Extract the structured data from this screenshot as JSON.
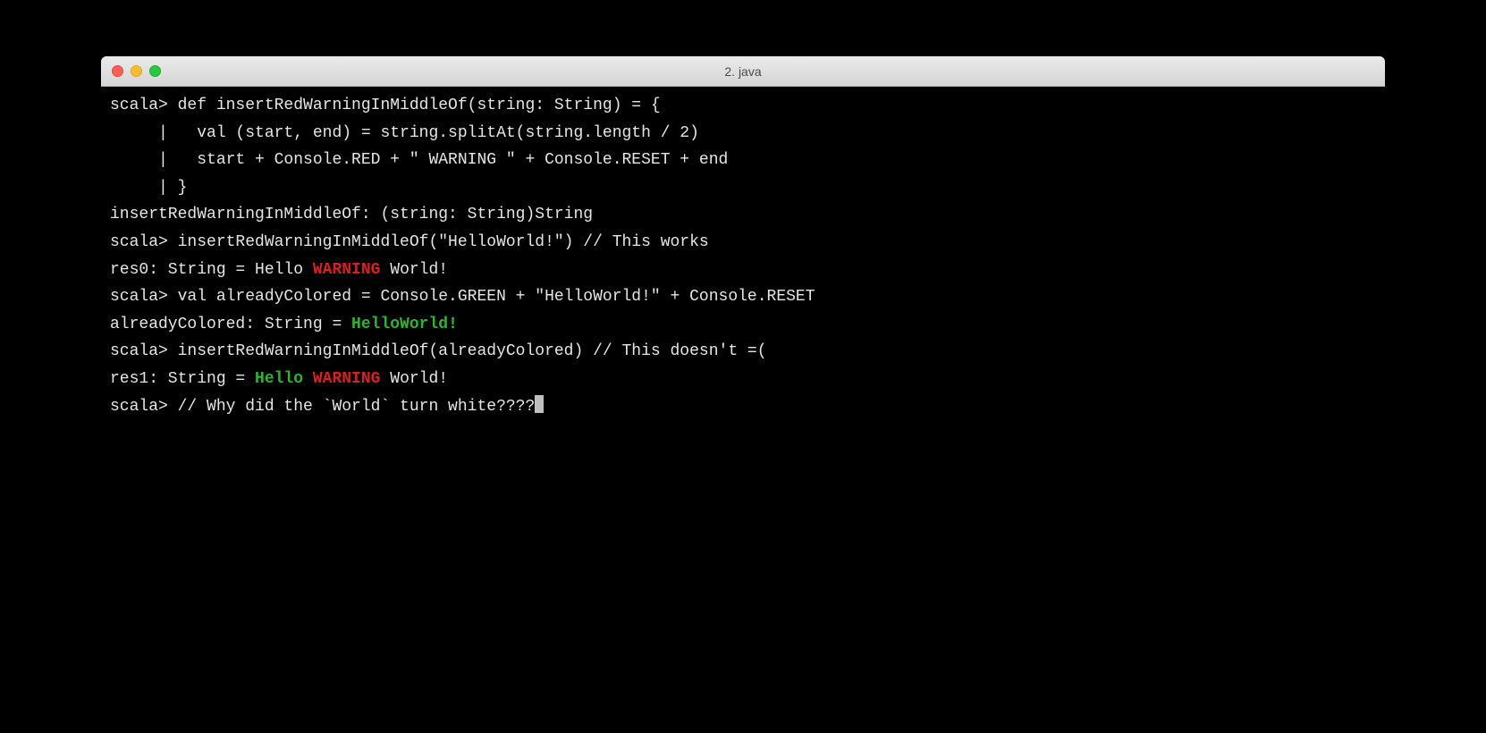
{
  "window": {
    "title": "2. java"
  },
  "lines": {
    "l1": "scala> def insertRedWarningInMiddleOf(string: String) = {",
    "l2": "     |   val (start, end) = string.splitAt(string.length / 2)",
    "l3": "     |   start + Console.RED + \" WARNING \" + Console.RESET + end",
    "l4": "     | }",
    "l5": "insertRedWarningInMiddleOf: (string: String)String",
    "l6": "",
    "l7": "scala> insertRedWarningInMiddleOf(\"HelloWorld!\") // This works",
    "l8a": "res0: String = Hello ",
    "l8b": "WARNING",
    "l8c": " World!",
    "l9": "",
    "l10": "scala> val alreadyColored = Console.GREEN + \"HelloWorld!\" + Console.RESET",
    "l11a": "alreadyColored: String = ",
    "l11b": "HelloWorld!",
    "l12": "",
    "l13": "scala> insertRedWarningInMiddleOf(alreadyColored) // This doesn't =(",
    "l14a": "res1: String = ",
    "l14b": "Hello ",
    "l14c": "WARNING",
    "l14d": " World!",
    "l15": "",
    "l16": "scala> // Why did the `World` turn white????"
  }
}
